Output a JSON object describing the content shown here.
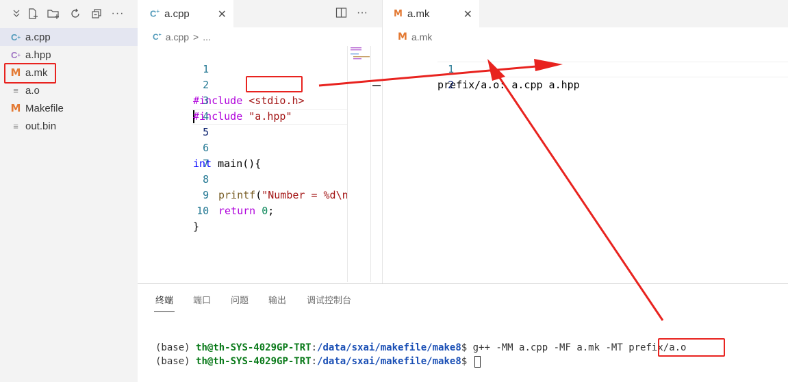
{
  "explorer": {
    "toolbar_icons": [
      "collapse-icon",
      "new-file-icon",
      "new-folder-icon",
      "refresh-icon",
      "collapse-all-icon",
      "more-icon"
    ],
    "files": [
      {
        "name": "a.cpp",
        "icon": "cpp-file-icon",
        "selected": true
      },
      {
        "name": "a.hpp",
        "icon": "hpp-file-icon",
        "selected": false
      },
      {
        "name": "a.mk",
        "icon": "makefile-icon",
        "selected": false
      },
      {
        "name": "a.o",
        "icon": "text-file-icon",
        "selected": false
      },
      {
        "name": "Makefile",
        "icon": "makefile-icon",
        "selected": false
      },
      {
        "name": "out.bin",
        "icon": "text-file-icon",
        "selected": false
      }
    ]
  },
  "left_editor": {
    "tab_label": "a.cpp",
    "breadcrumb_file": "a.cpp",
    "breadcrumb_sep": ">",
    "breadcrumb_more": "...",
    "line_numbers": [
      "1",
      "2",
      "3",
      "4",
      "5",
      "6",
      "7",
      "8",
      "9",
      "10"
    ],
    "code": {
      "l2_directive": "#include",
      "l2_header": "<stdio.h>",
      "l3_directive": "#include",
      "l3_header": "\"a.hpp\"",
      "l6_type": "int",
      "l6_rest": "main(){",
      "l8_fn": "printf",
      "l8_paren": "(",
      "l8_str": "\"Number = %d\\n",
      "l9_kw": "return",
      "l9_num": "0",
      "l9_semi": ";",
      "l10_brace": "}"
    }
  },
  "right_editor": {
    "tab_label": "a.mk",
    "breadcrumb_file": "a.mk",
    "line_numbers": [
      "1",
      "2"
    ],
    "line1": "prefix/a.o: a.cpp a.hpp"
  },
  "panel": {
    "tabs": [
      "终端",
      "端口",
      "问题",
      "输出",
      "调试控制台"
    ],
    "terminal": {
      "line1_env": "(base) ",
      "line1_host": "th@th-SYS-4029GP-TRT",
      "line1_colon": ":",
      "line1_path": "/data/sxai/makefile/make8",
      "line1_prompt": "$ ",
      "line1_cmd": "g++ -MM a.cpp -MF a.mk -MT ",
      "line1_target": "prefix/a.o",
      "line2_env": "(base) ",
      "line2_host": "th@th-SYS-4029GP-TRT",
      "line2_colon": ":",
      "line2_path": "/data/sxai/makefile/make8",
      "line2_prompt": "$ "
    }
  },
  "annotation_color": "#e8231f"
}
